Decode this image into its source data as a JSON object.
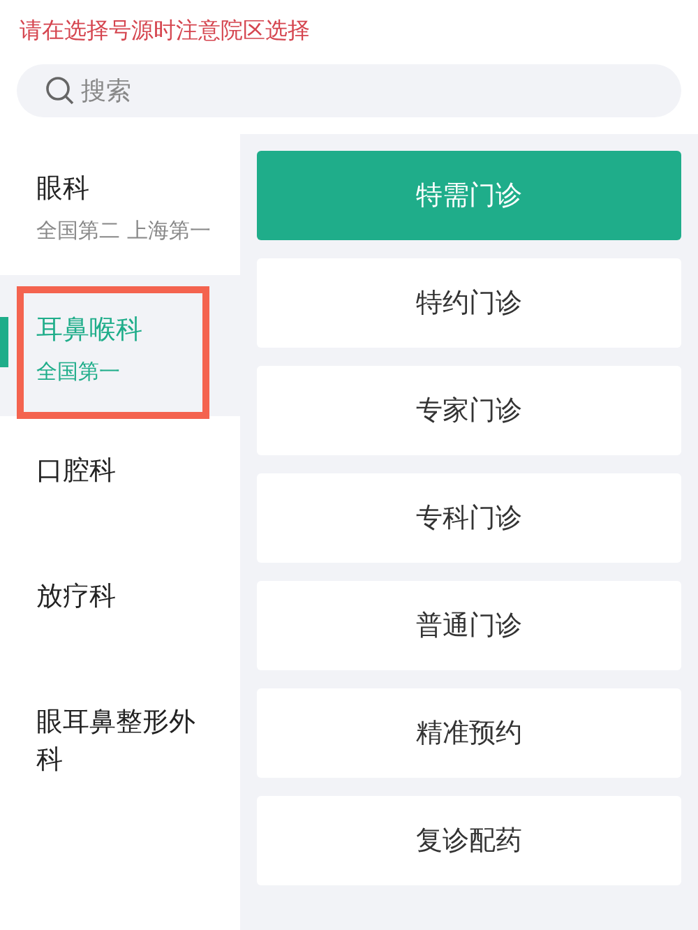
{
  "notice": "请在选择号源时注意院区选择",
  "search": {
    "placeholder": "搜索"
  },
  "departments": [
    {
      "name": "眼科",
      "note": "全国第二 上海第一",
      "selected": false,
      "highlighted": false
    },
    {
      "name": "耳鼻喉科",
      "note": "全国第一",
      "selected": true,
      "highlighted": true
    },
    {
      "name": "口腔科",
      "selected": false,
      "highlighted": false
    },
    {
      "name": "放疗科",
      "selected": false,
      "highlighted": false
    },
    {
      "name": "眼耳鼻整形外科",
      "selected": false,
      "highlighted": false
    }
  ],
  "clinic_types": [
    {
      "label": "特需门诊",
      "selected": true
    },
    {
      "label": "特约门诊",
      "selected": false
    },
    {
      "label": "专家门诊",
      "selected": false
    },
    {
      "label": "专科门诊",
      "selected": false
    },
    {
      "label": "普通门诊",
      "selected": false
    },
    {
      "label": "精准预约",
      "selected": false
    },
    {
      "label": "复诊配药",
      "selected": false
    }
  ]
}
